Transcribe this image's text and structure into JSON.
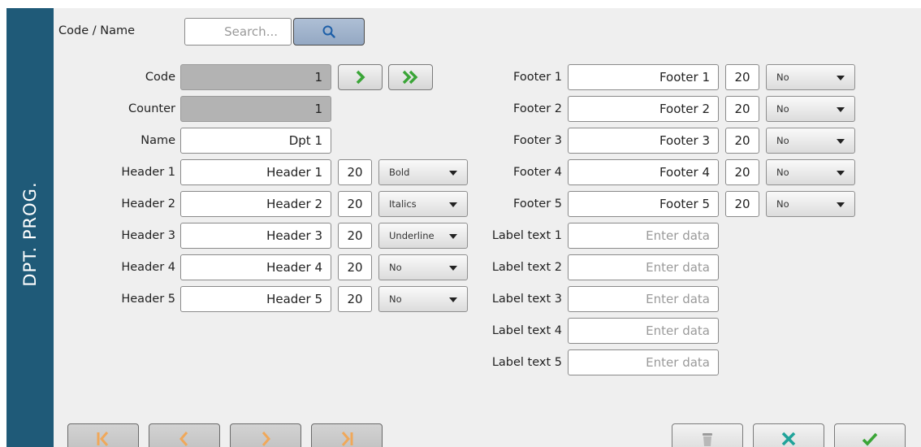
{
  "colors": {
    "sidebar": "#1f5a78",
    "panel": "#efefef",
    "green_arrow": "#3aa537",
    "orange_nav": "#f0a85a",
    "teal_x": "#1fa39a"
  },
  "sidebar": {
    "title": "DPT. PROG."
  },
  "search": {
    "label": "Code / Name",
    "placeholder": "Search...",
    "icon": "search-icon"
  },
  "left_form": {
    "code": {
      "label": "Code",
      "value": "1"
    },
    "counter": {
      "label": "Counter",
      "value": "1"
    },
    "name": {
      "label": "Name",
      "value": "Dpt 1"
    },
    "headers": [
      {
        "label": "Header 1",
        "value": "Header 1",
        "size": "20",
        "style": "Bold"
      },
      {
        "label": "Header 2",
        "value": "Header 2",
        "size": "20",
        "style": "Italics"
      },
      {
        "label": "Header 3",
        "value": "Header 3",
        "size": "20",
        "style": "Underline"
      },
      {
        "label": "Header 4",
        "value": "Header 4",
        "size": "20",
        "style": "No"
      },
      {
        "label": "Header 5",
        "value": "Header 5",
        "size": "20",
        "style": "No"
      }
    ]
  },
  "right_form": {
    "footers": [
      {
        "label": "Footer 1",
        "value": "Footer 1",
        "size": "20",
        "style": "No"
      },
      {
        "label": "Footer 2",
        "value": "Footer 2",
        "size": "20",
        "style": "No"
      },
      {
        "label": "Footer 3",
        "value": "Footer 3",
        "size": "20",
        "style": "No"
      },
      {
        "label": "Footer 4",
        "value": "Footer 4",
        "size": "20",
        "style": "No"
      },
      {
        "label": "Footer 5",
        "value": "Footer 5",
        "size": "20",
        "style": "No"
      }
    ],
    "labels": [
      {
        "label": "Label text 1",
        "placeholder": "Enter data"
      },
      {
        "label": "Label text 2",
        "placeholder": "Enter data"
      },
      {
        "label": "Label text 3",
        "placeholder": "Enter data"
      },
      {
        "label": "Label text 4",
        "placeholder": "Enter data"
      },
      {
        "label": "Label text 5",
        "placeholder": "Enter data"
      }
    ]
  },
  "buttons": {
    "next": "chevron-right-icon",
    "fast_forward": "double-chevron-right-icon",
    "first": "first-page-icon",
    "prev": "chevron-left-icon",
    "next_page": "chevron-right-icon",
    "last": "last-page-icon",
    "delete": "trash-icon",
    "cancel": "close-icon",
    "confirm": "check-icon"
  }
}
